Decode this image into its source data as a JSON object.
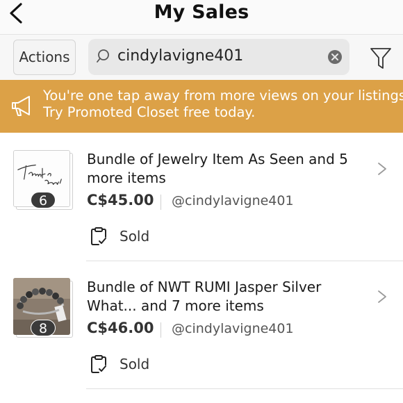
{
  "header": {
    "title": "My Sales",
    "back_icon": "chevron-left-icon"
  },
  "toolbar": {
    "actions_label": "Actions",
    "search_value": "cindylavigne401",
    "search_icon": "search-icon",
    "clear_icon": "clear-icon",
    "filter_icon": "filter-icon"
  },
  "promo": {
    "icon": "megaphone-icon",
    "line1": "You're one tap away from more views on your listings!",
    "line2": "Try Promoted Closet free today.",
    "background": "#dca147"
  },
  "sales": [
    {
      "title_line1": "Bundle of Jewelry Item As Seen and 5",
      "title_line2": "more items",
      "price": "C$45.00",
      "seller": "@cindylavigne401",
      "count": "6",
      "status": "Sold",
      "thumb_text": "Thank You!"
    },
    {
      "title_line1": "Bundle of NWT RUMI Jasper Silver",
      "title_line2": "What... and 7 more items",
      "price": "C$46.00",
      "seller": "@cindylavigne401",
      "count": "8",
      "status": "Sold"
    }
  ]
}
